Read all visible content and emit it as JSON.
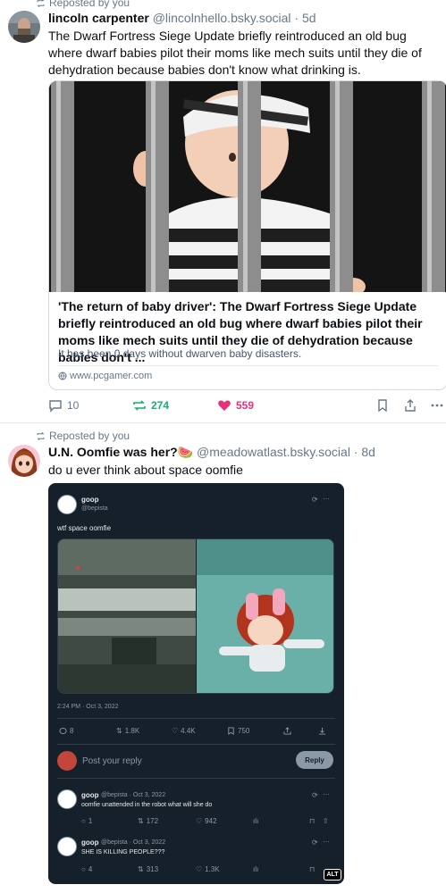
{
  "post1": {
    "repost_label": "Reposted by you",
    "author_name": "lincoln carpenter",
    "author_handle": "@lincolnhello.bsky.social",
    "time": "· 5d",
    "text": "The Dwarf Fortress Siege Update briefly reintroduced an old bug where dwarf babies pilot their moms like mech suits until they die of dehydration because babies don't know what drinking is.",
    "embed": {
      "title": "'The return of baby driver': The Dwarf Fortress Siege Update briefly reintroduced an old bug where dwarf babies pilot their moms like mech suits until they die of dehydration because babies don't ...",
      "description": "It has been 0 days without dwarven baby disasters.",
      "domain": "www.pcgamer.com"
    },
    "actions": {
      "replies": "10",
      "reposts": "274",
      "likes": "559"
    }
  },
  "post2": {
    "repost_label": "Reposted by you",
    "author_name": "U.N. Oomfie was her?🍉",
    "author_handle": "@meadowatlast.bsky.social",
    "time": "· 8d",
    "text": "do u ever think about space oomfie",
    "screenshot": {
      "name": "goop",
      "handle": "@bepista",
      "text": "wtf space oomfie",
      "timestamp": "2:24 PM · Oct 3, 2022",
      "stats": {
        "replies": "8",
        "retweets": "1.8K",
        "likes": "4.4K",
        "views": "750"
      },
      "reply_placeholder": "Post your reply",
      "reply_button": "Reply",
      "replies": [
        {
          "name": "goop",
          "meta": "@bepista · Oct 3, 2022",
          "text": "oomfie unattended in the robot what will she do",
          "stats": {
            "replies": "1",
            "retweets": "172",
            "likes": "942"
          }
        },
        {
          "name": "goop",
          "meta": "@bepista · Oct 3, 2022",
          "text": "SHE IS KILLING PEOPLE???",
          "stats": {
            "replies": "4",
            "retweets": "313",
            "likes": "1.3K"
          }
        }
      ]
    },
    "alt_label": "ALT"
  }
}
